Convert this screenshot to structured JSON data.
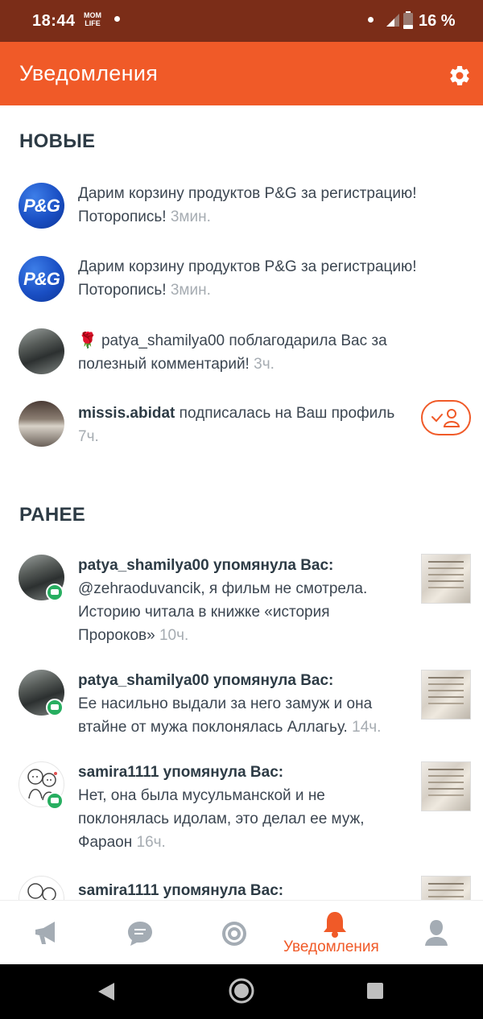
{
  "status_bar": {
    "time": "18:44",
    "app_badge_line1": "MOM",
    "app_badge_line2": "LIFE",
    "battery": "16 %"
  },
  "header": {
    "title": "Уведомления",
    "settings_icon": "gear-icon"
  },
  "sections": {
    "new_title": "НОВЫЕ",
    "earlier_title": "РАНЕЕ"
  },
  "new_items": [
    {
      "avatar_text": "P&G",
      "text": "Дарим корзину продуктов P&G за регистрацию! Поторопись!",
      "time": "3мин."
    },
    {
      "avatar_text": "P&G",
      "text": "Дарим корзину продуктов P&G за регистрацию! Поторопись!",
      "time": "3мин."
    },
    {
      "emoji": "🌹",
      "text": "patya_shamilya00 поблагодарила Вас за полезный комментарий!",
      "time": "3ч."
    },
    {
      "user": "missis.abidat",
      "text": "подписалась на Ваш профиль",
      "time": "7ч."
    }
  ],
  "earlier_items": [
    {
      "user": "patya_shamilya00",
      "action": "упомянула Вас:",
      "text": "@zehraoduvancik, я фильм не смотрела. Историю читала в книжке «история Пророков»",
      "time": "10ч."
    },
    {
      "user": "patya_shamilya00",
      "action": "упомянула Вас:",
      "text": "Ее насильно выдали за него замуж и она втайне от мужа поклонялась Аллагьу.",
      "time": "14ч."
    },
    {
      "user": "samira1111",
      "action": "упомянула Вас:",
      "text": "Нет, она была мусульманской и не поклонялась идолам, это делал ее муж, Фараон",
      "time": "16ч."
    },
    {
      "user": "samira1111",
      "action": "упомянула Вас:"
    }
  ],
  "bottom_nav": {
    "active_label": "Уведомления",
    "items": [
      "megaphone-icon",
      "chat-icon",
      "target-icon",
      "bell-icon",
      "profile-icon"
    ]
  },
  "colors": {
    "accent": "#f05a28",
    "status_bar": "#7b2d18",
    "badge_green": "#27ae60"
  }
}
